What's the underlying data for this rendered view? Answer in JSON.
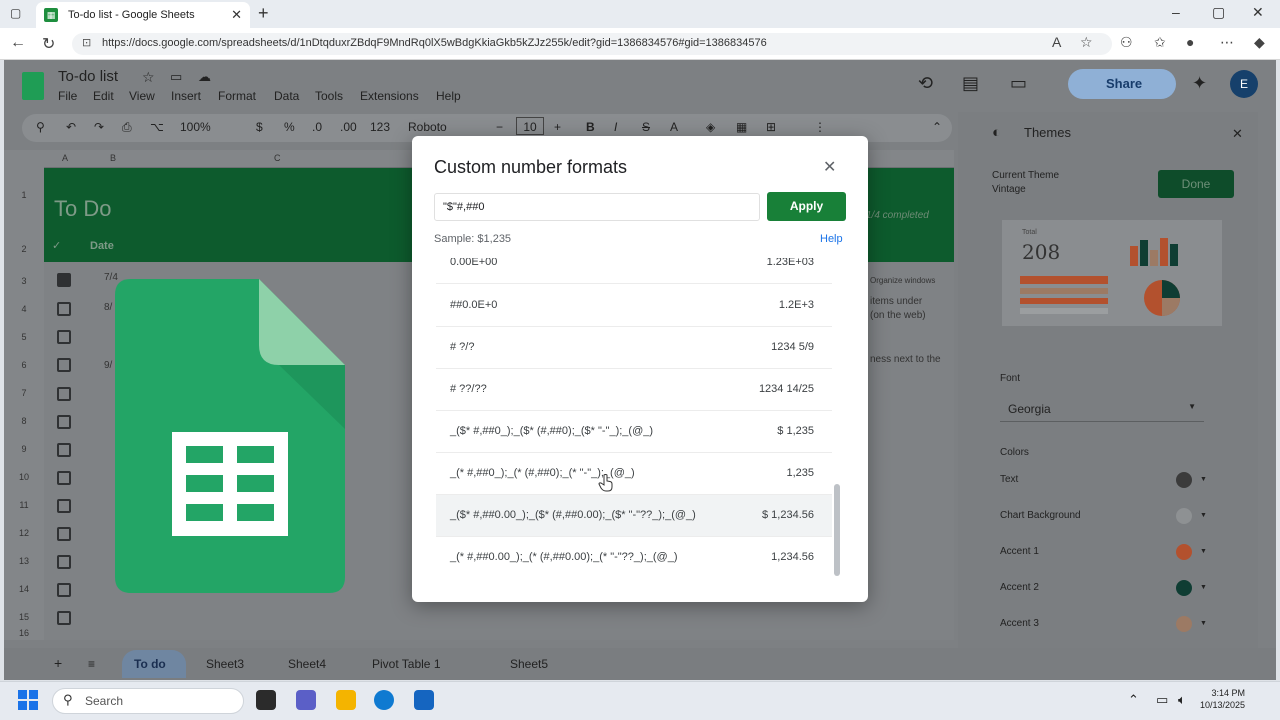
{
  "browser": {
    "tab_title": "To-do list - Google Sheets",
    "url": "https://docs.google.com/spreadsheets/d/1nDtqduxrZBdqF9MndRq0lX5wBdgKkiaGkb5kZJz255k/edit?gid=1386834576#gid=1386834576"
  },
  "sheets": {
    "doc_title": "To-do list",
    "menu": [
      "File",
      "Edit",
      "View",
      "Insert",
      "Format",
      "Data",
      "Tools",
      "Extensions",
      "Help"
    ],
    "share_label": "Share",
    "avatar_letter": "E",
    "toolbar": {
      "zoom": "100%",
      "currency": "$",
      "percent": "%",
      "decrease": ".0",
      "increase": ".00",
      "more_formats": "123",
      "font": "Roboto",
      "font_size": "10"
    },
    "columns": [
      "A",
      "B",
      "C"
    ],
    "banner_title": "To Do",
    "banner_progress": "1/4 completed",
    "date_header": "Date",
    "row_numbers": [
      "1",
      "2",
      "3",
      "4",
      "5",
      "6",
      "7",
      "8",
      "9",
      "10",
      "11",
      "12",
      "13",
      "14",
      "15",
      "16"
    ],
    "cells": {
      "r3b": "7/4",
      "r4b": "8/",
      "r6b": "9/"
    },
    "right_notes": [
      "Organize windows",
      "items under",
      "(on the web)",
      "ness next to the"
    ]
  },
  "themes": {
    "title": "Themes",
    "current_theme_label": "Current Theme",
    "current_theme_name": "Vintage",
    "done_label": "Done",
    "preview_number": "208",
    "preview_caption": "Total",
    "font_label": "Font",
    "font_value": "Georgia",
    "colors_label": "Colors",
    "colors": [
      {
        "label": "Text",
        "hex": "#3b3b3b"
      },
      {
        "label": "Chart Background",
        "hex": "#8e9193"
      },
      {
        "label": "Accent 1",
        "hex": "#b3512e"
      },
      {
        "label": "Accent 2",
        "hex": "#0f3d33"
      },
      {
        "label": "Accent 3",
        "hex": "#9c7a64"
      }
    ]
  },
  "sheet_tabs": [
    "To do",
    "Sheet3",
    "Sheet4",
    "Pivot Table 1",
    "Sheet5"
  ],
  "dialog": {
    "title": "Custom number formats",
    "input_value": "\"$\"#,##0",
    "apply_label": "Apply",
    "sample_label": "Sample: $1,235",
    "help_label": "Help",
    "formats": [
      {
        "format": "0.00E+00",
        "sample": "1.23E+03"
      },
      {
        "format": "##0.0E+0",
        "sample": "1.2E+3"
      },
      {
        "format": "# ?/?",
        "sample": "1234 5/9"
      },
      {
        "format": "# ??/??",
        "sample": "1234 14/25"
      },
      {
        "format": "_($* #,##0_);_($* (#,##0);_($* \"-\"_);_(@_)",
        "sample": "$ 1,235"
      },
      {
        "format": "_(* #,##0_);_(* (#,##0);_(* \"-\"_);_(@_)",
        "sample": "1,235"
      },
      {
        "format": "_($* #,##0.00_);_($* (#,##0.00);_($* \"-\"??_);_(@_)",
        "sample": "$ 1,234.56"
      },
      {
        "format": "_(* #,##0.00_);_(* (#,##0.00);_(* \"-\"??_);_(@_)",
        "sample": "1,234.56"
      }
    ]
  },
  "taskbar": {
    "search_placeholder": "Search",
    "time": "3:14 PM",
    "date": "10/13/2025"
  }
}
